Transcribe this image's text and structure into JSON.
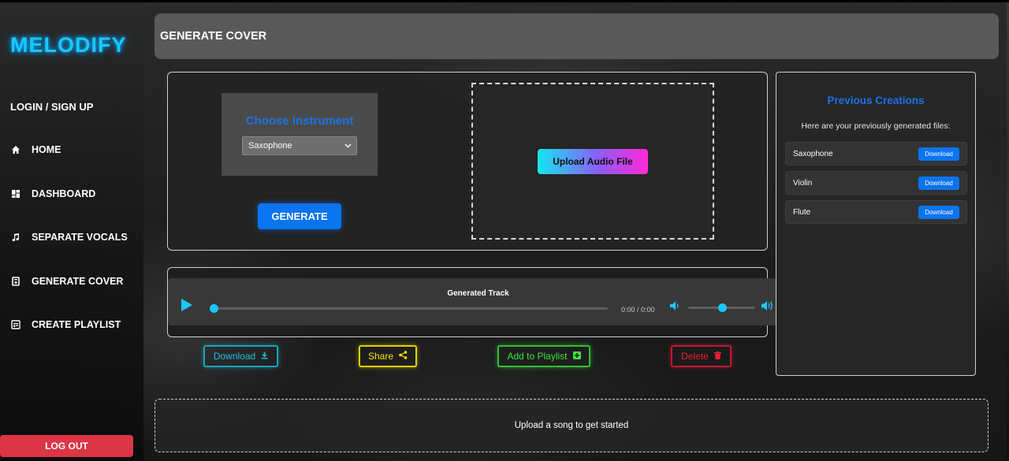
{
  "brand": "MELODIFY",
  "auth": {
    "login_label": "LOGIN / SIGN UP",
    "logout_label": "LOG OUT"
  },
  "nav": {
    "items": [
      {
        "label": "HOME",
        "icon": "home-icon"
      },
      {
        "label": "DASHBOARD",
        "icon": "dashboard-icon"
      },
      {
        "label": "SEPARATE VOCALS",
        "icon": "music-note-icon"
      },
      {
        "label": "GENERATE COVER",
        "icon": "radio-icon"
      },
      {
        "label": "CREATE PLAYLIST",
        "icon": "playlist-icon"
      }
    ]
  },
  "header": {
    "title": "GENERATE COVER"
  },
  "generator": {
    "instrument_title": "Choose Instrument",
    "instrument_selected": "Saxophone",
    "generate_label": "GENERATE",
    "upload_label": "Upload Audio File"
  },
  "player": {
    "track_title": "Generated Track",
    "time": "0:00 / 0:00",
    "progress": 0,
    "volume": 0.5
  },
  "actions": {
    "download_label": "Download",
    "share_label": "Share",
    "playlist_label": "Add to Playlist",
    "delete_label": "Delete"
  },
  "previous": {
    "title": "Previous Creations",
    "subtitle": "Here are your previously generated files:",
    "items": [
      {
        "name": "Saxophone",
        "button": "Download"
      },
      {
        "name": "Violin",
        "button": "Download"
      },
      {
        "name": "Flute",
        "button": "Download"
      }
    ]
  },
  "status": {
    "message": "Upload a song to get started"
  },
  "colors": {
    "brand": "#18c8ff",
    "accent_blue": "#0b74f0",
    "logout_red": "#dc3545"
  }
}
